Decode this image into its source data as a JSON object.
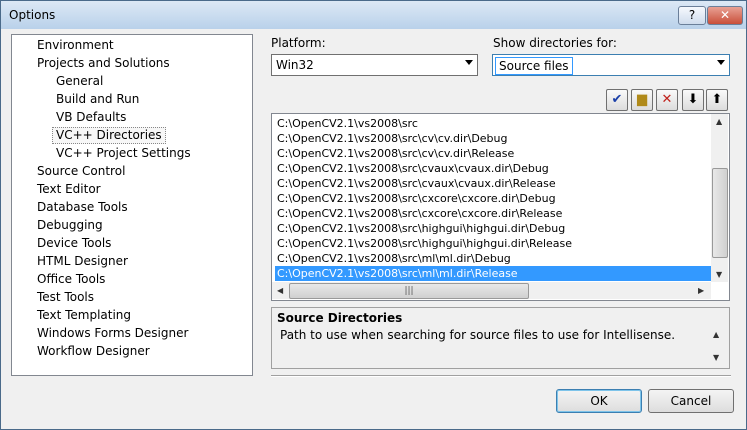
{
  "window": {
    "title": "Options",
    "help_label": "?",
    "close_label": "✕"
  },
  "tree": {
    "items": [
      {
        "label": "Environment",
        "level": 0
      },
      {
        "label": "Projects and Solutions",
        "level": 0
      },
      {
        "label": "General",
        "level": 1
      },
      {
        "label": "Build and Run",
        "level": 1
      },
      {
        "label": "VB Defaults",
        "level": 1
      },
      {
        "label": "VC++ Directories",
        "level": 1,
        "selected": true
      },
      {
        "label": "VC++ Project Settings",
        "level": 1
      },
      {
        "label": "Source Control",
        "level": 0
      },
      {
        "label": "Text Editor",
        "level": 0
      },
      {
        "label": "Database Tools",
        "level": 0
      },
      {
        "label": "Debugging",
        "level": 0
      },
      {
        "label": "Device Tools",
        "level": 0
      },
      {
        "label": "HTML Designer",
        "level": 0
      },
      {
        "label": "Office Tools",
        "level": 0
      },
      {
        "label": "Test Tools",
        "level": 0
      },
      {
        "label": "Text Templating",
        "level": 0
      },
      {
        "label": "Windows Forms Designer",
        "level": 0
      },
      {
        "label": "Workflow Designer",
        "level": 0
      }
    ]
  },
  "platform": {
    "label": "Platform:",
    "value": "Win32"
  },
  "show_dirs": {
    "label": "Show directories for:",
    "value": "Source files"
  },
  "toolbar": {
    "check_icon": "check-icon",
    "new_folder_icon": "new-folder-icon",
    "delete_icon": "delete-icon",
    "down_icon": "arrow-down-icon",
    "up_icon": "arrow-up-icon"
  },
  "directories": [
    "C:\\OpenCV2.1\\vs2008\\src",
    "C:\\OpenCV2.1\\vs2008\\src\\cv\\cv.dir\\Debug",
    "C:\\OpenCV2.1\\vs2008\\src\\cv\\cv.dir\\Release",
    "C:\\OpenCV2.1\\vs2008\\src\\cvaux\\cvaux.dir\\Debug",
    "C:\\OpenCV2.1\\vs2008\\src\\cvaux\\cvaux.dir\\Release",
    "C:\\OpenCV2.1\\vs2008\\src\\cxcore\\cxcore.dir\\Debug",
    "C:\\OpenCV2.1\\vs2008\\src\\cxcore\\cxcore.dir\\Release",
    "C:\\OpenCV2.1\\vs2008\\src\\highgui\\highgui.dir\\Debug",
    "C:\\OpenCV2.1\\vs2008\\src\\highgui\\highgui.dir\\Release",
    "C:\\OpenCV2.1\\vs2008\\src\\ml\\ml.dir\\Debug",
    "C:\\OpenCV2.1\\vs2008\\src\\ml\\ml.dir\\Release"
  ],
  "selected_directory_index": 10,
  "description": {
    "title": "Source Directories",
    "text": "Path to use when searching for source files to use for Intellisense."
  },
  "buttons": {
    "ok": "OK",
    "cancel": "Cancel"
  },
  "colors": {
    "selection": "#3399ff",
    "title_bar": "#b9d1ea",
    "close": "#c94f3a"
  }
}
